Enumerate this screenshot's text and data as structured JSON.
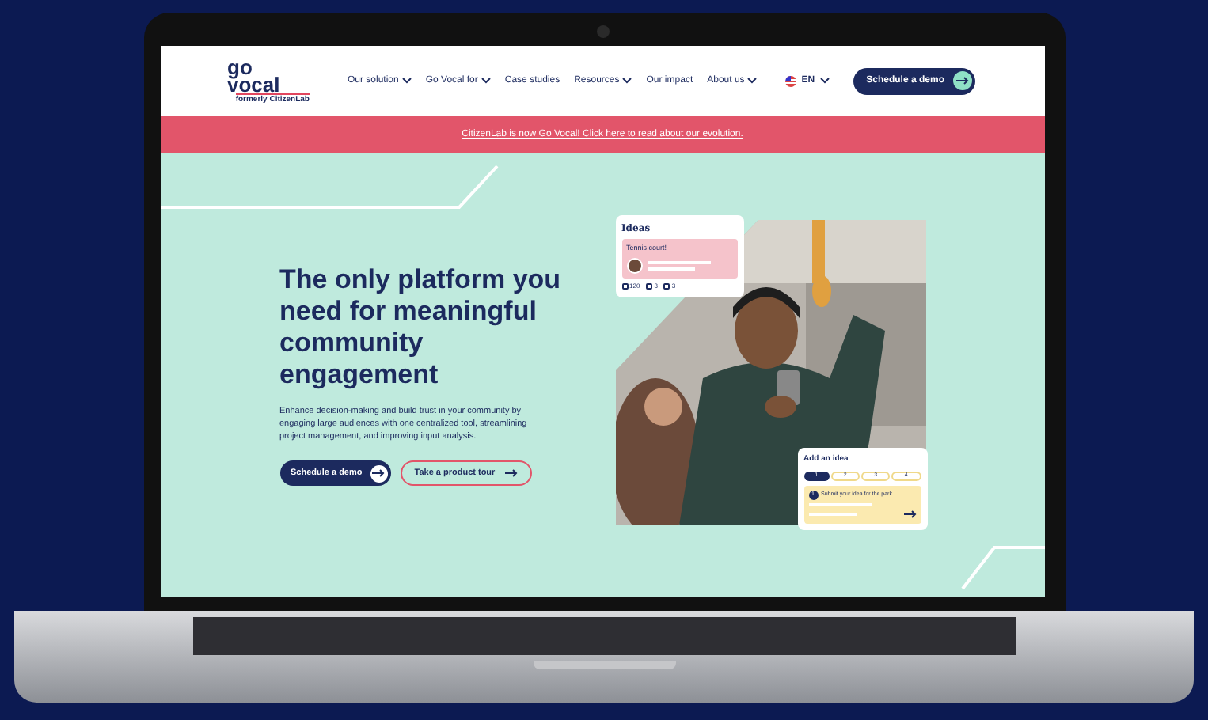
{
  "logo": {
    "line_1": "go",
    "line_2": "vocal",
    "tagline": "formerly CitizenLab"
  },
  "nav": [
    {
      "label": "Our solution",
      "dropdown": true
    },
    {
      "label": "Go Vocal for",
      "dropdown": true
    },
    {
      "label": "Case studies",
      "dropdown": false
    },
    {
      "label": "Resources",
      "dropdown": true
    },
    {
      "label": "Our impact",
      "dropdown": false
    },
    {
      "label": "About us",
      "dropdown": true
    }
  ],
  "language": "EN",
  "header_button": "Schedule a demo",
  "banner": "CitizenLab is now Go Vocal! Click here to read about our evolution.",
  "hero": {
    "title": "The only platform you need for meaningful community engagement",
    "body": "Enhance decision-making and build trust in your community by engaging large audiences with one centralized tool, streamlining project management, and improving input analysis.",
    "buttons": [
      {
        "label": "Schedule a demo",
        "kind": "primary"
      },
      {
        "label": "Take a product tour",
        "kind": "outline"
      }
    ]
  },
  "ideas_card": {
    "title": "Ideas",
    "idea": "Tennis court!",
    "stats": [
      "120",
      "3",
      "3"
    ]
  },
  "add_card": {
    "title": "Add an idea",
    "steps": [
      {
        "label": "1",
        "selected": true
      },
      {
        "label": "2",
        "selected": false
      },
      {
        "label": "3",
        "selected": false
      },
      {
        "label": "4",
        "selected": false
      }
    ],
    "step_number": "1",
    "prompt": "Submit your idea for the park"
  }
}
